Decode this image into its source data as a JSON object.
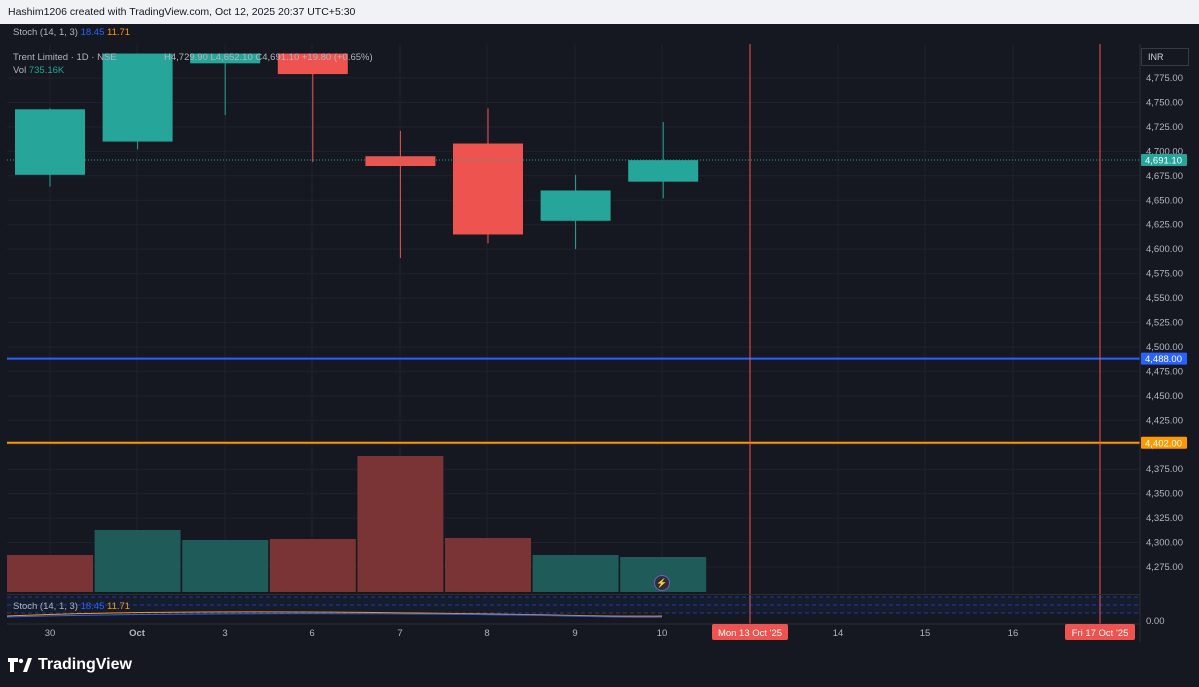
{
  "header": {
    "text": "Hashim1206 created with TradingView.com, Oct 12, 2025 20:37 UTC+5:30"
  },
  "top_indicator": {
    "name": "Stoch (14, 1, 3)",
    "k": "18.45",
    "d": "11.71"
  },
  "symbol": {
    "title": "Trent Limited · 1D · NSE",
    "open_label": "O",
    "high": "H4,729.90",
    "low": "L4,652.10",
    "close": "C4,691.10",
    "change": "+19.80 (+0.65%)"
  },
  "volume": {
    "label": "Vol",
    "value": "735.16K"
  },
  "currency": "INR",
  "bottom_indicator": {
    "name": "Stoch (14, 1, 3)",
    "k": "18.45",
    "d": "11.71"
  },
  "brand": "TradingView",
  "chart_data": {
    "type": "candlestick",
    "y_ticks": [
      "4,775.00",
      "4,750.00",
      "4,725.00",
      "4,700.00",
      "4,675.00",
      "4,650.00",
      "4,625.00",
      "4,600.00",
      "4,575.00",
      "4,550.00",
      "4,525.00",
      "4,500.00",
      "4,475.00",
      "4,450.00",
      "4,425.00",
      "4,400.00",
      "4,375.00",
      "4,350.00",
      "4,325.00",
      "4,300.00",
      "4,275.00"
    ],
    "x_ticks": [
      "30",
      "Oct",
      "3",
      "6",
      "7",
      "8",
      "9",
      "10",
      "14",
      "15",
      "16"
    ],
    "date_tags": [
      "Mon 13 Oct '25",
      "Fri 17 Oct '25"
    ],
    "stoch_tick": "0.00",
    "candles": [
      {
        "date": "30",
        "open": 4676,
        "high": 4744,
        "low": 4664,
        "close": 4743
      },
      {
        "date": "Oct",
        "open": 4710,
        "high": 4800,
        "low": 4702,
        "close": 4800
      },
      {
        "date": "3",
        "open": 4790,
        "high": 4800,
        "low": 4737,
        "close": 4800
      },
      {
        "date": "6",
        "open": 4800,
        "high": 4800,
        "low": 4689,
        "close": 4779
      },
      {
        "date": "7",
        "open": 4695,
        "high": 4721,
        "low": 4591,
        "close": 4685
      },
      {
        "date": "8",
        "open": 4708,
        "high": 4744,
        "low": 4606,
        "close": 4615
      },
      {
        "date": "9",
        "open": 4629,
        "high": 4676,
        "low": 4600,
        "close": 4660
      },
      {
        "date": "10",
        "open": 4669,
        "high": 4730,
        "low": 4652,
        "close": 4691
      }
    ],
    "volume": [
      {
        "date": "30",
        "value": 37,
        "up": false
      },
      {
        "date": "Oct",
        "value": 62,
        "up": true
      },
      {
        "date": "3",
        "value": 52,
        "up": true
      },
      {
        "date": "6",
        "value": 53,
        "up": false
      },
      {
        "date": "7",
        "value": 136,
        "up": false
      },
      {
        "date": "8",
        "value": 54,
        "up": false
      },
      {
        "date": "9",
        "value": 37,
        "up": true
      },
      {
        "date": "10",
        "value": 35,
        "up": true
      }
    ],
    "last_price": {
      "value": 4691.1,
      "label": "4,691.10",
      "color": "#26a69a"
    },
    "hlines": [
      {
        "value": 4488,
        "label": "4,488.00",
        "color": "#2962ff"
      },
      {
        "value": 4402,
        "label": "4,402.00",
        "color": "#ff9800"
      }
    ],
    "vlines_color": "#ef5350",
    "ylim": [
      4250,
      4800
    ],
    "colors": {
      "up": "#26a69a",
      "down": "#ef5350",
      "vol_up": "#1f5b59",
      "vol_down": "#7b3435"
    }
  }
}
